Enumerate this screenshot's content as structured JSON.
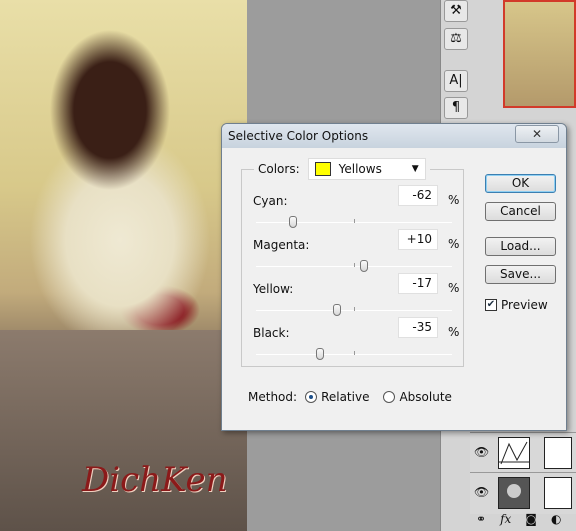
{
  "dialog": {
    "title": "Selective Color Options",
    "close": "✕",
    "colors_label": "Colors:",
    "colors_value": "Yellows",
    "colors_swatch": "#ffff00",
    "sliders": [
      {
        "label": "Cyan:",
        "value": "-62",
        "pct": "%",
        "num": -62
      },
      {
        "label": "Magenta:",
        "value": "+10",
        "pct": "%",
        "num": 10
      },
      {
        "label": "Yellow:",
        "value": "-17",
        "pct": "%",
        "num": -17
      },
      {
        "label": "Black:",
        "value": "-35",
        "pct": "%",
        "num": -35
      }
    ],
    "method_label": "Method:",
    "method_options": [
      "Relative",
      "Absolute"
    ],
    "method_selected": "Relative",
    "buttons": {
      "ok": "OK",
      "cancel": "Cancel",
      "load": "Load...",
      "save": "Save..."
    },
    "preview_label": "Preview",
    "preview_checked": true
  },
  "photo": {
    "signature": "DichKen"
  },
  "tools": [
    "puppet-icon",
    "stamp-icon",
    "A|",
    "¶"
  ],
  "layers": [
    {
      "name": "curves-adjustment"
    },
    {
      "name": "vignette"
    }
  ],
  "layer_footer": [
    "link-icon",
    "fx",
    "mask-icon",
    "adjustment-icon"
  ]
}
